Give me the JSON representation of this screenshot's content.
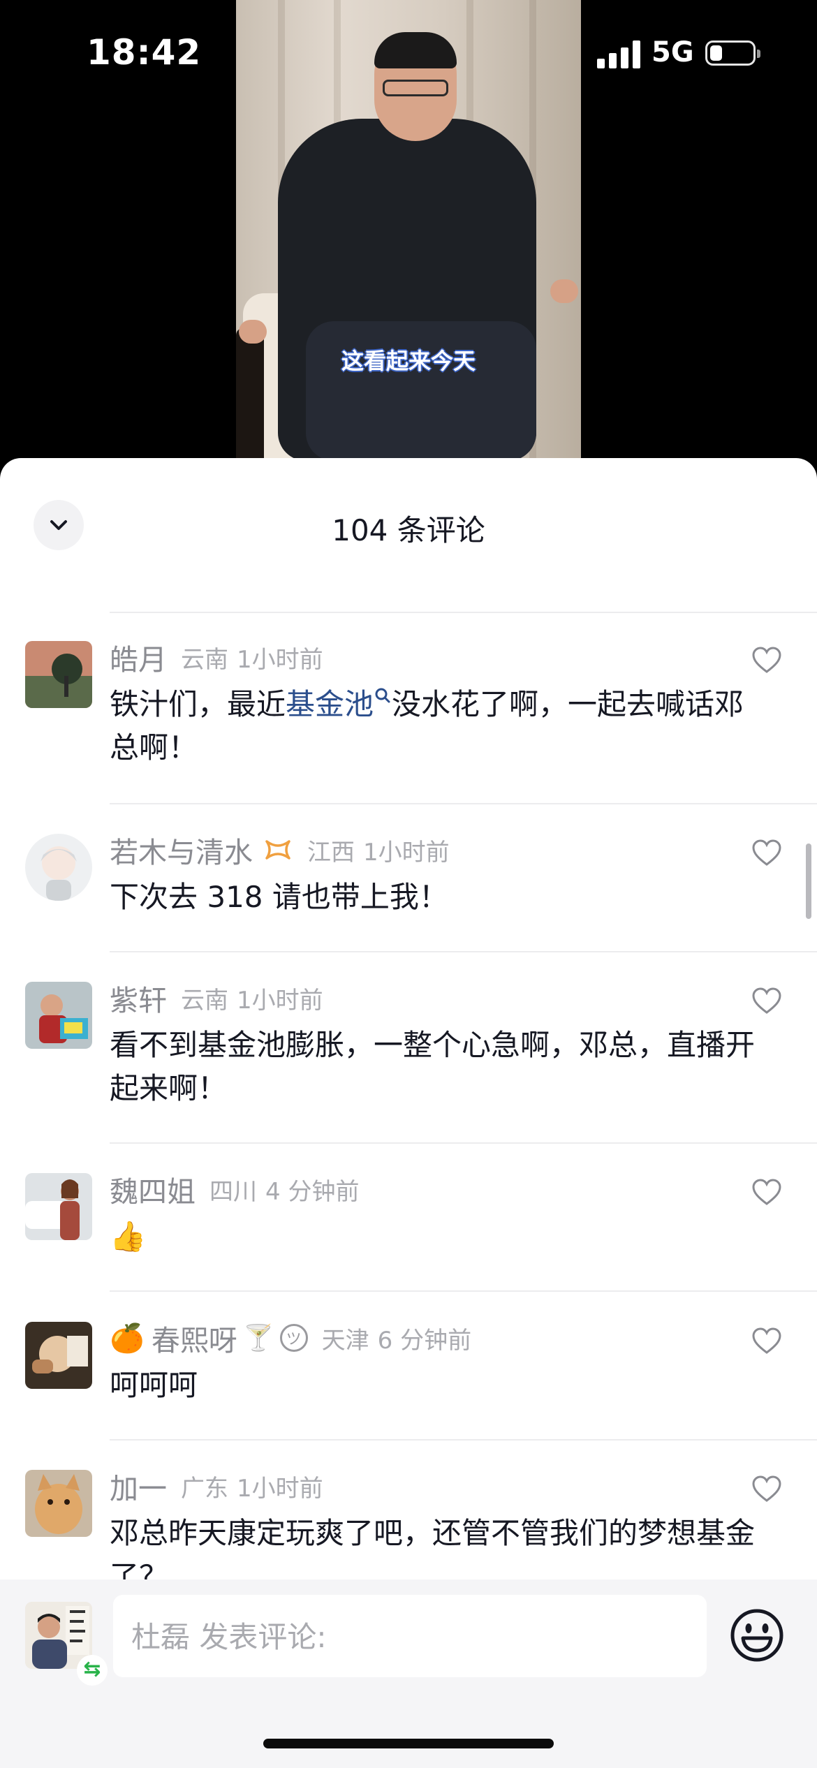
{
  "status_bar": {
    "time": "18:42",
    "network": "5G",
    "battery_level": 0.3
  },
  "video": {
    "subtitle": "这看起来今天"
  },
  "panel": {
    "title": "104 条评论"
  },
  "comments": [
    {
      "user": "皓月",
      "location": "云南",
      "time": "1小时前",
      "text_before": "铁汁们，最近",
      "text_link": "基金池",
      "text_after": "没水花了啊，一起去喊话邓总啊！"
    },
    {
      "user": "若木与清水",
      "location": "江西",
      "time": "1小时前",
      "badge": "vip-badge-icon",
      "text": "下次去 318 请也带上我！"
    },
    {
      "user": "紫轩",
      "location": "云南",
      "time": "1小时前",
      "text": "看不到基金池膨胀，一整个心急啊，邓总，直播开起来啊！"
    },
    {
      "user": "魏四姐",
      "location": "四川",
      "time": "4 分钟前",
      "text": "👍"
    },
    {
      "user": "春熙呀",
      "user_prefix": "🍊",
      "user_suffix": "🍸",
      "location": "天津",
      "time": "6 分钟前",
      "text": "呵呵呵"
    },
    {
      "user": "加一",
      "location": "广东",
      "time": "1小时前",
      "text": "邓总昨天康定玩爽了吧，还管不管我们的梦想基金了？"
    }
  ],
  "input": {
    "placeholder": "杜磊 发表评论:"
  },
  "colors": {
    "link": "#2b4e8c",
    "meta": "#a9aaaf",
    "swap": "#29b34a",
    "vip": "#f0a040"
  },
  "icons": [
    "chevron-down-icon",
    "heart-icon",
    "search-icon",
    "vip-badge-icon",
    "smile-icon",
    "emoji-icon",
    "swap-icon"
  ]
}
